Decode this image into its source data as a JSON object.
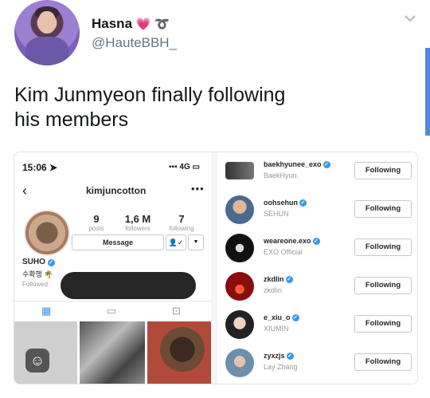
{
  "tweet": {
    "name": "Hasna",
    "name_emoji": "💗",
    "handle": "@HauteBBH_",
    "text_line1": "Kim Junmyeon finally following",
    "text_line2": "his members",
    "menu_icon": "chevron-down-icon"
  },
  "instagram_profile": {
    "time": "15:06",
    "signal": "4G",
    "username": "kimjuncotton",
    "posts_count": "9",
    "posts_label": "posts",
    "followers_count": "1,6 M",
    "followers_label": "followers",
    "following_count": "7",
    "following_label": "following",
    "message_button": "Message",
    "display_name": "SUHO",
    "bio": "수확행 🌴",
    "followed_by": "Followed"
  },
  "following_list": {
    "button_label": "Following",
    "items": [
      {
        "username": "baekhyunee_exo",
        "subtitle": "BaekHyun."
      },
      {
        "username": "oohsehun",
        "subtitle": "SEHUN"
      },
      {
        "username": "weareone.exo",
        "subtitle": "EXO Official"
      },
      {
        "username": "zkdlin",
        "subtitle": "zkdlin"
      },
      {
        "username": "e_xiu_o",
        "subtitle": "XIUMIN"
      },
      {
        "username": "zyxzjs",
        "subtitle": "Lay Zhang"
      }
    ]
  },
  "colors": {
    "verified": "#3897f0",
    "text": "#14171a",
    "muted": "#657786"
  }
}
